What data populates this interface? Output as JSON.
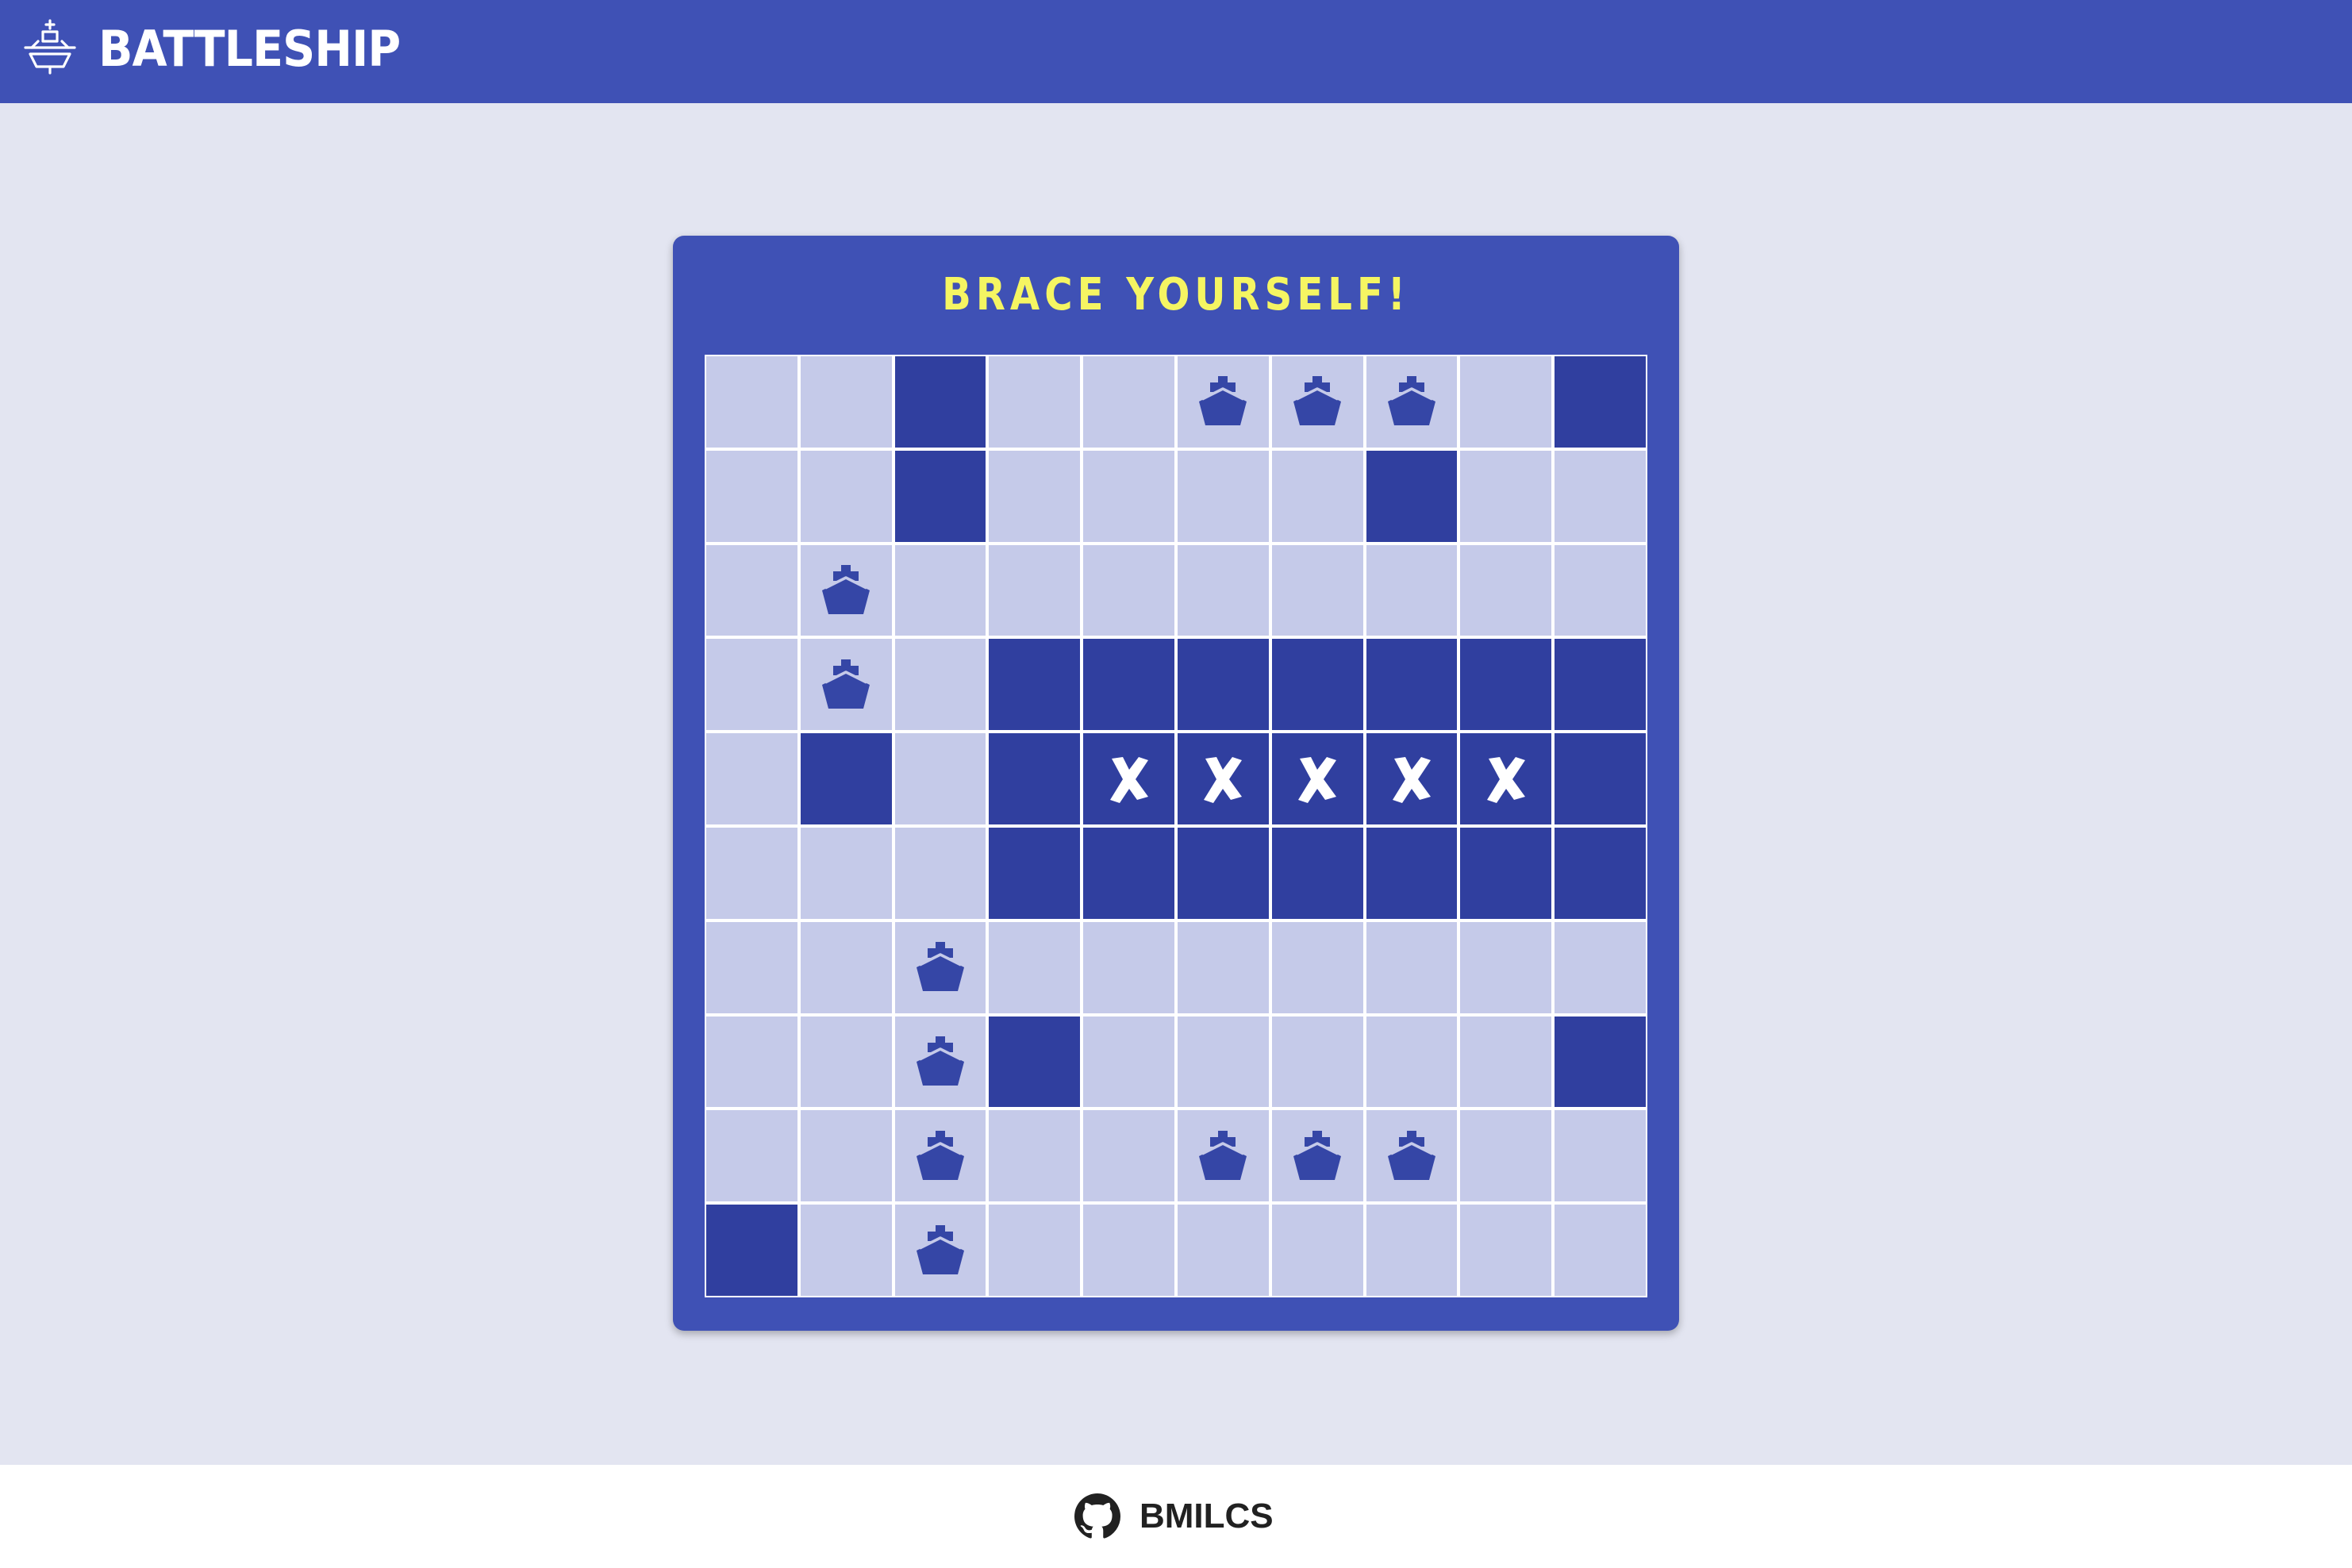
{
  "app": {
    "title": "BATTLESHIP",
    "logo_icon": "battleship-icon"
  },
  "board": {
    "heading": "BRACE YOURSELF!",
    "size": 10,
    "legend": {
      "E": "empty",
      "M": "miss",
      "S": "ship",
      "X": "hit"
    },
    "rows": [
      "EEMEESSSEM",
      "EEMEEEEMEE",
      "ESEEEEEEEE",
      "ESEMMMMMMM",
      "EMEMXXXXXM",
      "EEEMMMMMMM",
      "EESEEEEEEE",
      "EESMEEEEEM",
      "EESEESSSEE",
      "MESEEEEEEE"
    ]
  },
  "footer": {
    "link_label": "BMILCS",
    "icon": "github-icon"
  },
  "colors": {
    "header_bg": "#3f51b5",
    "page_bg": "#e3e5f1",
    "cell_empty": "#c5cae9",
    "cell_dark": "#303f9f",
    "ship_icon": "#3546a6",
    "heading_text": "#f5f562",
    "footer_bg": "#ffffff"
  }
}
